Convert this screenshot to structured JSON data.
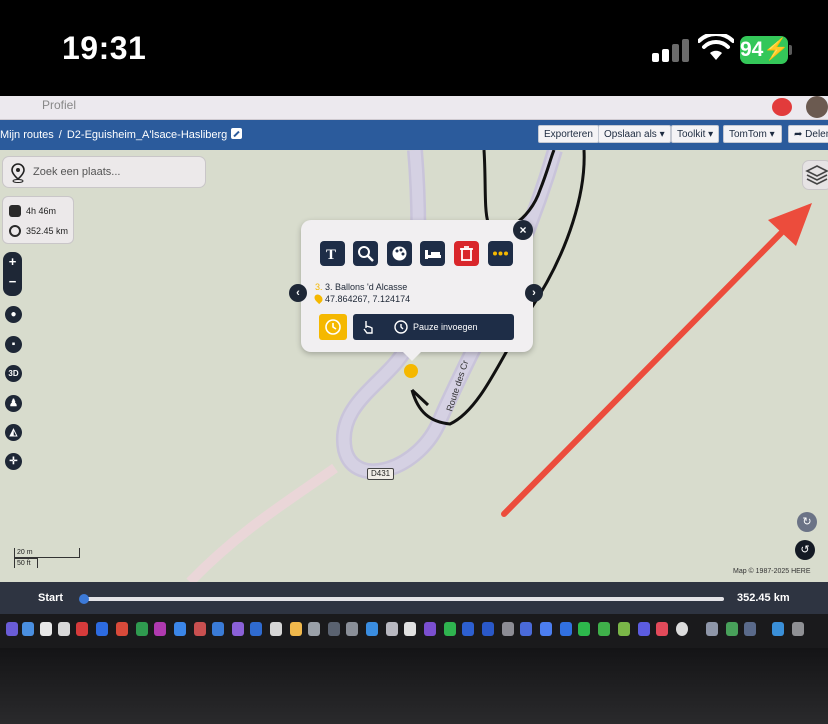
{
  "statusbar": {
    "time": "19:31",
    "battery": "94",
    "battery_color": "#34c759"
  },
  "browser": {
    "tab_text": "Profiel"
  },
  "app": {
    "breadcrumb_root": "Mijn routes",
    "breadcrumb_separator": "/",
    "route_name": "D2-Eguisheim_A'lsace-Hasliberg",
    "toolbar": {
      "export": "Exporteren",
      "save_as": "Opslaan als",
      "toolkit": "Toolkit",
      "tomtom": "TomTom",
      "share": "Delen"
    },
    "accent_color": "#2b5b9c"
  },
  "map": {
    "search_placeholder": "Zoek een plaats...",
    "stats": {
      "duration": "4h 46m",
      "distance": "352.45 km"
    },
    "controls": {
      "zoom_in": "+",
      "zoom_out": "−",
      "three_d": "3D"
    },
    "road_label": "Route des Cr",
    "road_badge": "D431",
    "scale": {
      "metric": "20 m",
      "imperial": "50 ft"
    },
    "credit": "Map © 1987-2025 HERE",
    "icons": [
      "search-pin-icon",
      "car-icon",
      "route-icon",
      "layers-icon",
      "location-icon",
      "lock-icon",
      "person-icon",
      "chart-icon",
      "crosshair-icon"
    ]
  },
  "popup": {
    "waypoint_number": "3.",
    "waypoint_name": "3. Ballons 'd Alcasse",
    "coordinates": "47.864267, 7.124174",
    "pause_label": "Pauze invoegen",
    "close": "×",
    "prev": "‹",
    "next": "›",
    "tools": [
      "text-icon",
      "zoom-icon",
      "palette-icon",
      "bed-icon",
      "trash-icon",
      "more-icon"
    ]
  },
  "profile": {
    "start_label": "Start",
    "total_distance": "352.45 km",
    "progress": 0
  },
  "annotation": {
    "arrow_color": "#ec4c3c"
  }
}
